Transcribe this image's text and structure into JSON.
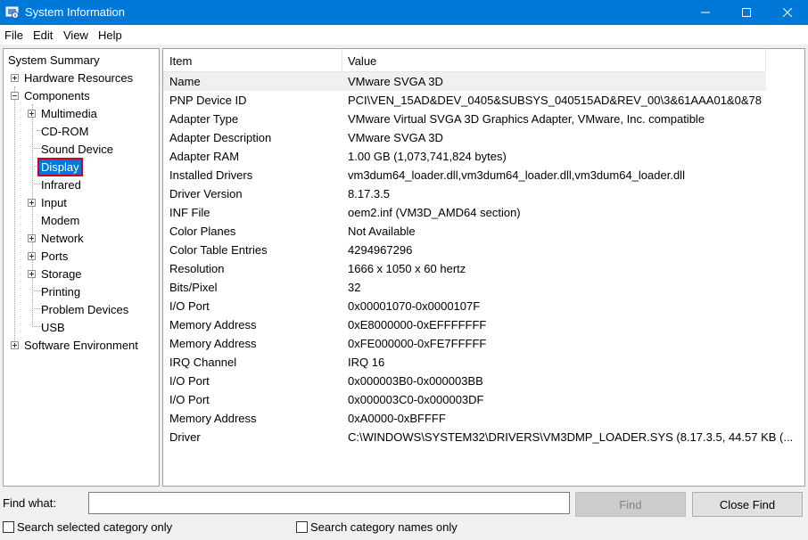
{
  "window": {
    "title": "System Information",
    "icon": "system-information-icon",
    "controls": {
      "minimize": "minimize-icon",
      "maximize": "maximize-icon",
      "close": "close-icon"
    }
  },
  "menu": [
    "File",
    "Edit",
    "View",
    "Help"
  ],
  "tree": {
    "root": "System Summary",
    "hardware": "Hardware Resources",
    "components": "Components",
    "component_items": [
      "Multimedia",
      "CD-ROM",
      "Sound Device",
      "Display",
      "Infrared",
      "Input",
      "Modem",
      "Network",
      "Ports",
      "Storage",
      "Printing",
      "Problem Devices",
      "USB"
    ],
    "software": "Software Environment",
    "selected": "Display"
  },
  "table": {
    "headers": {
      "item": "Item",
      "value": "Value"
    },
    "rows": [
      {
        "item": "Name",
        "value": "VMware SVGA 3D"
      },
      {
        "item": "PNP Device ID",
        "value": "PCI\\VEN_15AD&DEV_0405&SUBSYS_040515AD&REV_00\\3&61AAA01&0&78"
      },
      {
        "item": "Adapter Type",
        "value": "VMware Virtual SVGA 3D Graphics Adapter, VMware, Inc. compatible"
      },
      {
        "item": "Adapter Description",
        "value": "VMware SVGA 3D"
      },
      {
        "item": "Adapter RAM",
        "value": "1.00 GB (1,073,741,824 bytes)"
      },
      {
        "item": "Installed Drivers",
        "value": "vm3dum64_loader.dll,vm3dum64_loader.dll,vm3dum64_loader.dll"
      },
      {
        "item": "Driver Version",
        "value": "8.17.3.5"
      },
      {
        "item": "INF File",
        "value": "oem2.inf (VM3D_AMD64 section)"
      },
      {
        "item": "Color Planes",
        "value": "Not Available"
      },
      {
        "item": "Color Table Entries",
        "value": "4294967296"
      },
      {
        "item": "Resolution",
        "value": "1666 x 1050 x 60 hertz"
      },
      {
        "item": "Bits/Pixel",
        "value": "32"
      },
      {
        "item": "I/O Port",
        "value": "0x00001070-0x0000107F"
      },
      {
        "item": "Memory Address",
        "value": "0xE8000000-0xEFFFFFFF"
      },
      {
        "item": "Memory Address",
        "value": "0xFE000000-0xFE7FFFFF"
      },
      {
        "item": "IRQ Channel",
        "value": "IRQ 16"
      },
      {
        "item": "I/O Port",
        "value": "0x000003B0-0x000003BB"
      },
      {
        "item": "I/O Port",
        "value": "0x000003C0-0x000003DF"
      },
      {
        "item": "Memory Address",
        "value": "0xA0000-0xBFFFF"
      },
      {
        "item": "Driver",
        "value": "C:\\WINDOWS\\SYSTEM32\\DRIVERS\\VM3DMP_LOADER.SYS (8.17.3.5, 44.57 KB (..."
      }
    ]
  },
  "find": {
    "label": "Find what:",
    "value": "",
    "find_button": "Find",
    "close_find_button": "Close Find",
    "search_selected": "Search selected category only",
    "search_names": "Search category names only"
  },
  "colors": {
    "titlebar": "#0078d7",
    "selection": "#0078d7",
    "highlight_border": "#d0021b"
  }
}
